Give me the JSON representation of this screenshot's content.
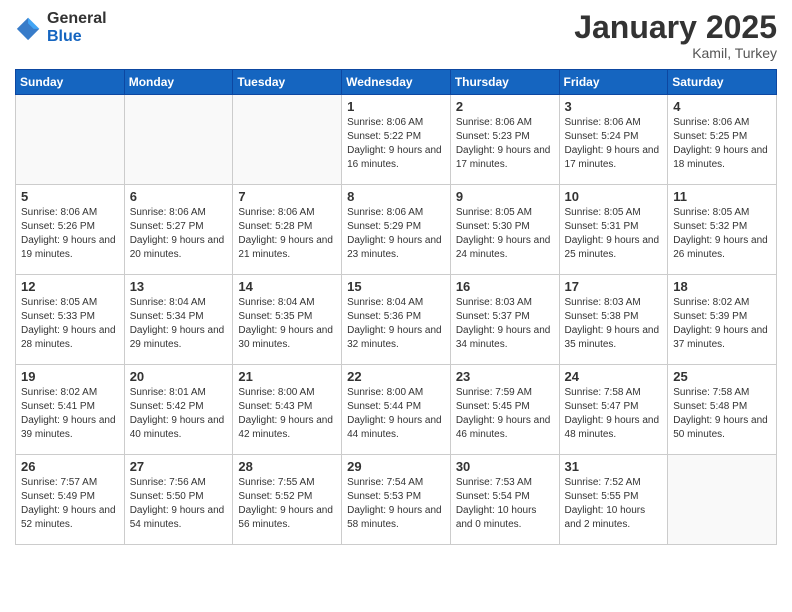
{
  "header": {
    "logo_general": "General",
    "logo_blue": "Blue",
    "title": "January 2025",
    "subtitle": "Kamil, Turkey"
  },
  "weekdays": [
    "Sunday",
    "Monday",
    "Tuesday",
    "Wednesday",
    "Thursday",
    "Friday",
    "Saturday"
  ],
  "weeks": [
    [
      {
        "day": "",
        "info": ""
      },
      {
        "day": "",
        "info": ""
      },
      {
        "day": "",
        "info": ""
      },
      {
        "day": "1",
        "info": "Sunrise: 8:06 AM\nSunset: 5:22 PM\nDaylight: 9 hours\nand 16 minutes."
      },
      {
        "day": "2",
        "info": "Sunrise: 8:06 AM\nSunset: 5:23 PM\nDaylight: 9 hours\nand 17 minutes."
      },
      {
        "day": "3",
        "info": "Sunrise: 8:06 AM\nSunset: 5:24 PM\nDaylight: 9 hours\nand 17 minutes."
      },
      {
        "day": "4",
        "info": "Sunrise: 8:06 AM\nSunset: 5:25 PM\nDaylight: 9 hours\nand 18 minutes."
      }
    ],
    [
      {
        "day": "5",
        "info": "Sunrise: 8:06 AM\nSunset: 5:26 PM\nDaylight: 9 hours\nand 19 minutes."
      },
      {
        "day": "6",
        "info": "Sunrise: 8:06 AM\nSunset: 5:27 PM\nDaylight: 9 hours\nand 20 minutes."
      },
      {
        "day": "7",
        "info": "Sunrise: 8:06 AM\nSunset: 5:28 PM\nDaylight: 9 hours\nand 21 minutes."
      },
      {
        "day": "8",
        "info": "Sunrise: 8:06 AM\nSunset: 5:29 PM\nDaylight: 9 hours\nand 23 minutes."
      },
      {
        "day": "9",
        "info": "Sunrise: 8:05 AM\nSunset: 5:30 PM\nDaylight: 9 hours\nand 24 minutes."
      },
      {
        "day": "10",
        "info": "Sunrise: 8:05 AM\nSunset: 5:31 PM\nDaylight: 9 hours\nand 25 minutes."
      },
      {
        "day": "11",
        "info": "Sunrise: 8:05 AM\nSunset: 5:32 PM\nDaylight: 9 hours\nand 26 minutes."
      }
    ],
    [
      {
        "day": "12",
        "info": "Sunrise: 8:05 AM\nSunset: 5:33 PM\nDaylight: 9 hours\nand 28 minutes."
      },
      {
        "day": "13",
        "info": "Sunrise: 8:04 AM\nSunset: 5:34 PM\nDaylight: 9 hours\nand 29 minutes."
      },
      {
        "day": "14",
        "info": "Sunrise: 8:04 AM\nSunset: 5:35 PM\nDaylight: 9 hours\nand 30 minutes."
      },
      {
        "day": "15",
        "info": "Sunrise: 8:04 AM\nSunset: 5:36 PM\nDaylight: 9 hours\nand 32 minutes."
      },
      {
        "day": "16",
        "info": "Sunrise: 8:03 AM\nSunset: 5:37 PM\nDaylight: 9 hours\nand 34 minutes."
      },
      {
        "day": "17",
        "info": "Sunrise: 8:03 AM\nSunset: 5:38 PM\nDaylight: 9 hours\nand 35 minutes."
      },
      {
        "day": "18",
        "info": "Sunrise: 8:02 AM\nSunset: 5:39 PM\nDaylight: 9 hours\nand 37 minutes."
      }
    ],
    [
      {
        "day": "19",
        "info": "Sunrise: 8:02 AM\nSunset: 5:41 PM\nDaylight: 9 hours\nand 39 minutes."
      },
      {
        "day": "20",
        "info": "Sunrise: 8:01 AM\nSunset: 5:42 PM\nDaylight: 9 hours\nand 40 minutes."
      },
      {
        "day": "21",
        "info": "Sunrise: 8:00 AM\nSunset: 5:43 PM\nDaylight: 9 hours\nand 42 minutes."
      },
      {
        "day": "22",
        "info": "Sunrise: 8:00 AM\nSunset: 5:44 PM\nDaylight: 9 hours\nand 44 minutes."
      },
      {
        "day": "23",
        "info": "Sunrise: 7:59 AM\nSunset: 5:45 PM\nDaylight: 9 hours\nand 46 minutes."
      },
      {
        "day": "24",
        "info": "Sunrise: 7:58 AM\nSunset: 5:47 PM\nDaylight: 9 hours\nand 48 minutes."
      },
      {
        "day": "25",
        "info": "Sunrise: 7:58 AM\nSunset: 5:48 PM\nDaylight: 9 hours\nand 50 minutes."
      }
    ],
    [
      {
        "day": "26",
        "info": "Sunrise: 7:57 AM\nSunset: 5:49 PM\nDaylight: 9 hours\nand 52 minutes."
      },
      {
        "day": "27",
        "info": "Sunrise: 7:56 AM\nSunset: 5:50 PM\nDaylight: 9 hours\nand 54 minutes."
      },
      {
        "day": "28",
        "info": "Sunrise: 7:55 AM\nSunset: 5:52 PM\nDaylight: 9 hours\nand 56 minutes."
      },
      {
        "day": "29",
        "info": "Sunrise: 7:54 AM\nSunset: 5:53 PM\nDaylight: 9 hours\nand 58 minutes."
      },
      {
        "day": "30",
        "info": "Sunrise: 7:53 AM\nSunset: 5:54 PM\nDaylight: 10 hours\nand 0 minutes."
      },
      {
        "day": "31",
        "info": "Sunrise: 7:52 AM\nSunset: 5:55 PM\nDaylight: 10 hours\nand 2 minutes."
      },
      {
        "day": "",
        "info": ""
      }
    ]
  ]
}
